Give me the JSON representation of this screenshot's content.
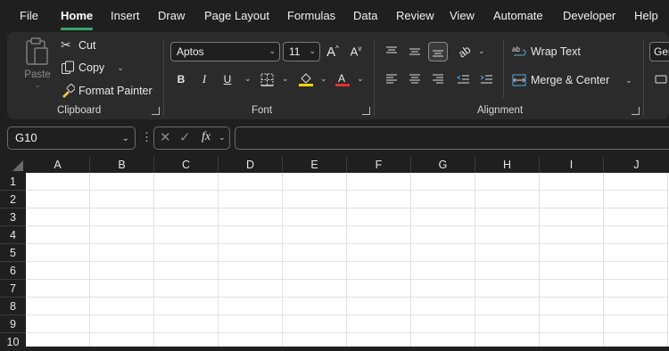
{
  "menu": {
    "tabs": [
      "File",
      "Home",
      "Insert",
      "Draw",
      "Page Layout",
      "Formulas",
      "Data",
      "Review",
      "View",
      "Automate",
      "Developer",
      "Help"
    ],
    "active": "Home"
  },
  "ribbon": {
    "clipboard": {
      "group_label": "Clipboard",
      "paste": "Paste",
      "cut": "Cut",
      "copy": "Copy",
      "format_painter": "Format Painter"
    },
    "font": {
      "group_label": "Font",
      "font_name": "Aptos",
      "font_size": "11",
      "bold": "B",
      "italic": "I",
      "underline": "U",
      "highlight_color": "#f2d600",
      "font_color": "#e03030"
    },
    "alignment": {
      "group_label": "Alignment",
      "wrap_text": "Wrap Text",
      "merge_center": "Merge & Center"
    },
    "number": {
      "format_partial": "Gen"
    }
  },
  "formula_bar": {
    "name_box": "G10",
    "formula": ""
  },
  "grid": {
    "columns": [
      "A",
      "B",
      "C",
      "D",
      "E",
      "F",
      "G",
      "H",
      "I",
      "J"
    ],
    "rows": [
      "1",
      "2",
      "3",
      "4",
      "5",
      "6",
      "7",
      "8",
      "9",
      "10"
    ]
  },
  "colors": {
    "accent": "#37a36a",
    "ribbon_bg": "#2b2b2b",
    "app_bg": "#1f1f1f"
  }
}
